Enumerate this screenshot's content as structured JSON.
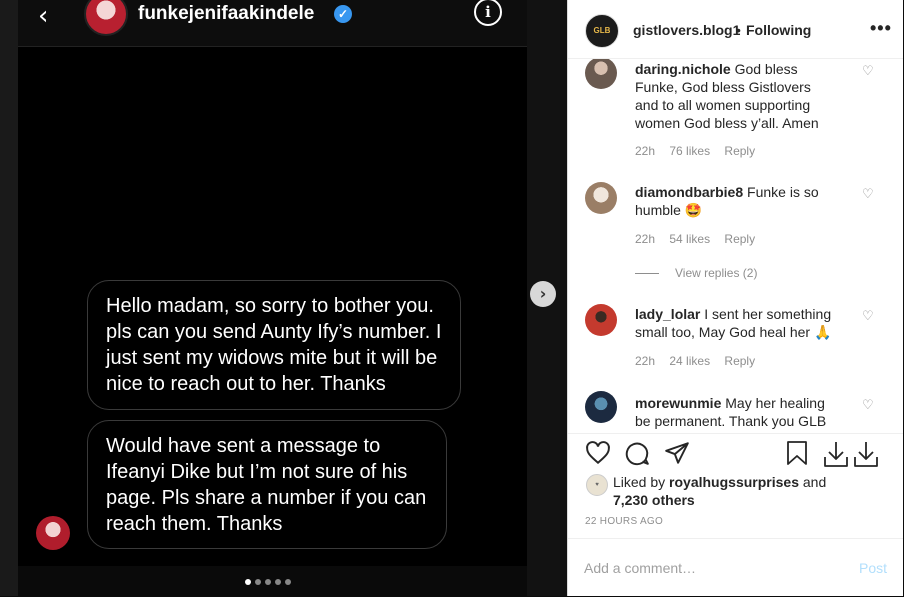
{
  "dm": {
    "username": "funkejenifaakindele",
    "messages": [
      "Hello madam, so sorry to bother you. pls can you send Aunty Ify’s number. I just sent my widows mite but it will be nice to reach out to her. Thanks",
      "Would have sent a message to Ifeanyi Dike but I’m not sure of his page. Pls share a number if you can reach them. Thanks"
    ],
    "carousel": {
      "count": 5,
      "active": 1
    }
  },
  "post": {
    "author": "gistlovers.blog1",
    "follow_status": "Following",
    "avatar_text": "GLB"
  },
  "comments": [
    {
      "user": "daring.nichole",
      "text": "God bless Funke, God bless Gistlovers and to all women supporting women God bless y’all. Amen",
      "time": "22h",
      "likes": "76 likes",
      "reply": "Reply"
    },
    {
      "user": "diamondbarbie8",
      "text": "Funke is so humble 🤩",
      "time": "22h",
      "likes": "54 likes",
      "reply": "Reply",
      "view_replies": "View replies (2)"
    },
    {
      "user": "lady_lolar",
      "text": "I sent her something small too, May God heal her 🙏",
      "time": "22h",
      "likes": "24 likes",
      "reply": "Reply"
    },
    {
      "user": "morewunmie",
      "text": "May her healing be permanent. Thank you GLB for all",
      "time": "",
      "likes": "",
      "reply": ""
    }
  ],
  "likes": {
    "prefix": "Liked by",
    "user": "royalhugssurprises",
    "and": "and",
    "others": "7,230 others"
  },
  "timestamp": "22 HOURS AGO",
  "add_comment": {
    "placeholder": "Add a comment…",
    "post_label": "Post"
  },
  "colors": {
    "accent": "#3897f0",
    "post_disabled": "#b2dffc",
    "meta": "#8e8e8e"
  }
}
